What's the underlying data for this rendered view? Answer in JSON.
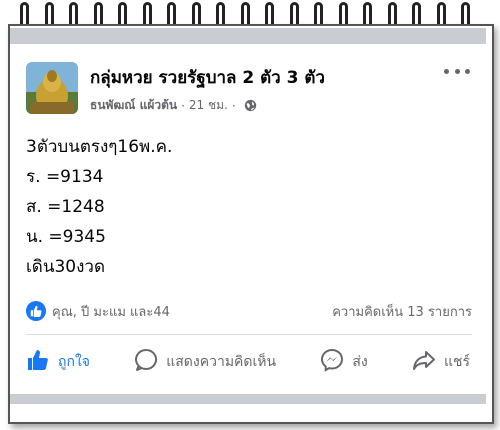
{
  "post": {
    "group_name": "กลุ่มหวย รวยรัฐบาล 2 ตัว 3 ตัว",
    "author": "ธนพัฒณ์ แผ้วต้น",
    "time": "21 ชม.",
    "body_lines": [
      "3ตัวบนตรงๆ16พ.ค.",
      "ร. =9134",
      "ส. =1248",
      "น. =9345",
      "เดิน30งวด"
    ],
    "reactions_text": "คุณ, ปี มะแม และ44",
    "comments_text": "ความคิดเห็น 13 รายการ"
  },
  "actions": {
    "like": "ถูกใจ",
    "comment": "แสดงความคิดเห็น",
    "send": "ส่ง",
    "share": "แชร์"
  },
  "colors": {
    "brand_blue": "#1877f2",
    "secondary_text": "#65676b",
    "primary_text": "#050505"
  },
  "icons": [
    "more-icon",
    "globe-icon",
    "like-reaction-icon",
    "like-icon",
    "comment-icon",
    "messenger-icon",
    "share-icon"
  ]
}
